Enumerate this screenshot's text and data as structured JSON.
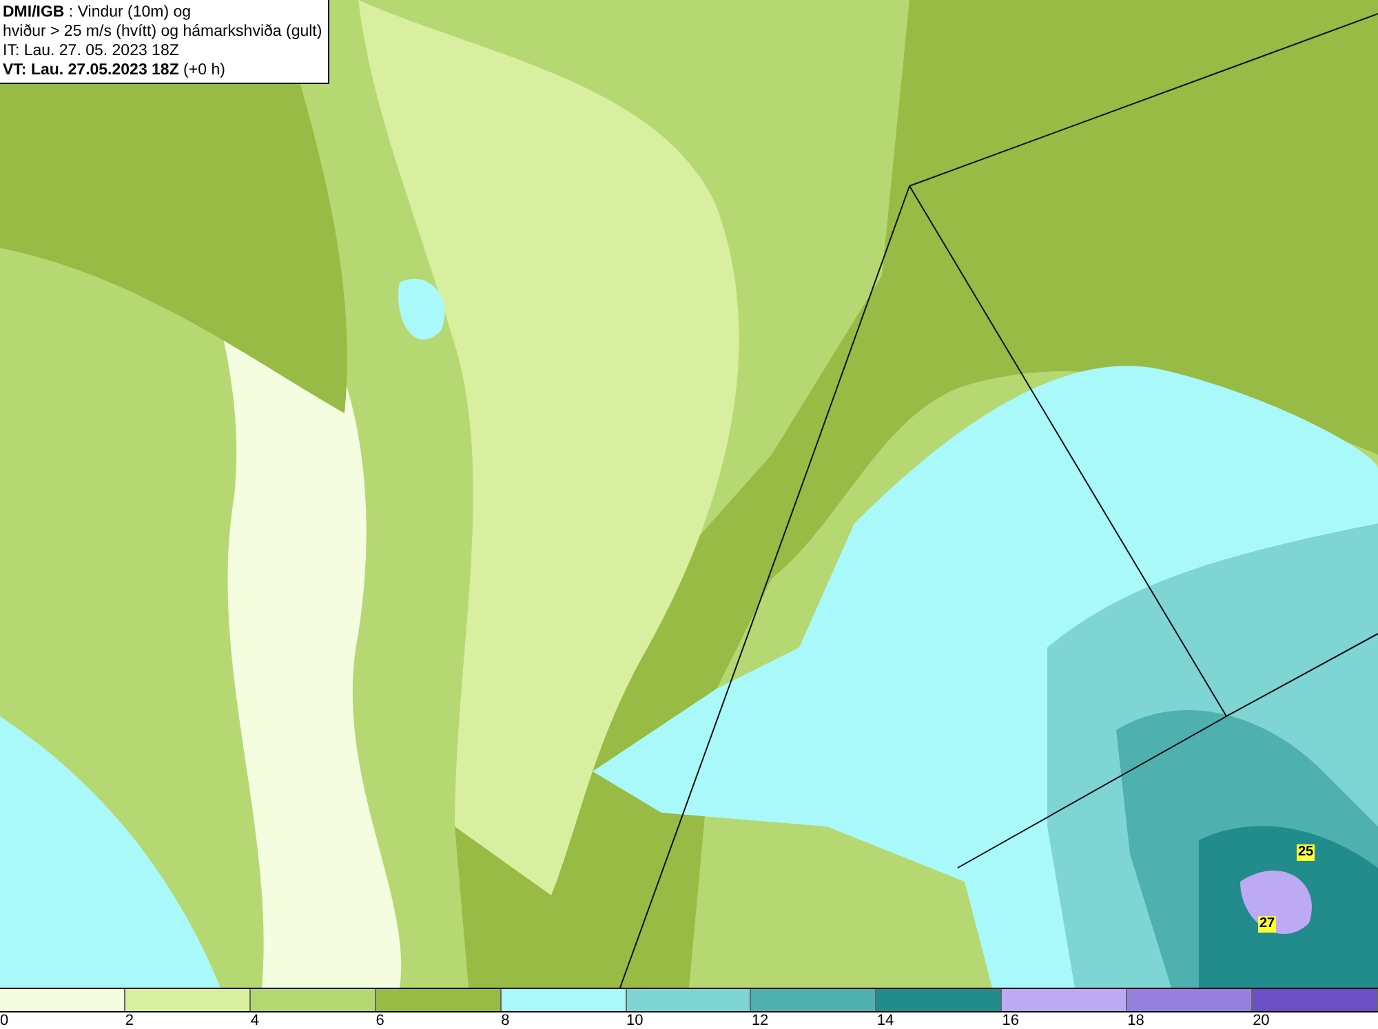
{
  "info_box": {
    "lines": [
      "**DMI/IGB** : Vindur (10m) og",
      "hviður > 25 m/s (hvítt) og hámarkshviða (gult)",
      "IT: Lau. 27. 05. 2023 18Z",
      "**VT: Lau. 27.05.2023 18Z** (+0 h)"
    ]
  },
  "map": {
    "gust_labels": [
      {
        "text": "25"
      },
      {
        "text": "27"
      }
    ]
  },
  "colorbar": [
    {
      "label": "0",
      "color": "#f5fde0"
    },
    {
      "label": "2",
      "color": "#d8ef9f"
    },
    {
      "label": "4",
      "color": "#b6d873"
    },
    {
      "label": "6",
      "color": "#97bb45"
    },
    {
      "label": "8",
      "color": "#a9f9fb"
    },
    {
      "label": "10",
      "color": "#7fd4d4"
    },
    {
      "label": "12",
      "color": "#4fb0b0"
    },
    {
      "label": "14",
      "color": "#228b8b"
    },
    {
      "label": "16",
      "color": "#bcaaf5"
    },
    {
      "label": "18",
      "color": "#9580e0"
    },
    {
      "label": "20",
      "color": "#6b4fc4"
    }
  ]
}
